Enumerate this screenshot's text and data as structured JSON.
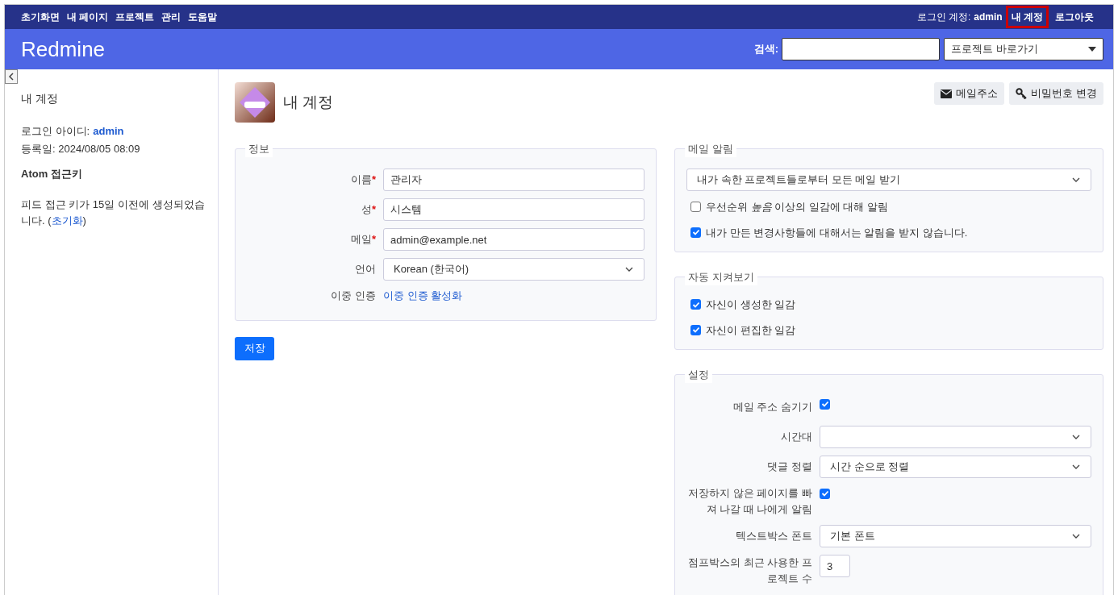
{
  "top_menu": {
    "items": [
      {
        "label": "초기화면"
      },
      {
        "label": "내 페이지"
      },
      {
        "label": "프로젝트"
      },
      {
        "label": "관리"
      },
      {
        "label": "도움말"
      }
    ],
    "logged_in_label": "로그인 계정:",
    "logged_in_user": "admin",
    "account_items": [
      {
        "label": "내 계정",
        "highlighted": true
      },
      {
        "label": "로그아웃",
        "highlighted": false
      }
    ]
  },
  "header": {
    "title": "Redmine",
    "search_label": "검색:",
    "jump_placeholder": "프로젝트 바로가기"
  },
  "sidebar": {
    "title": "내 계정",
    "login_label": "로그인 아이디:",
    "login_value": "admin",
    "registered": "등록일: 2024/08/05 08:09",
    "atom_title": "Atom 접근키",
    "feed_text": "피드 접근 키가 15일 이전에 생성되었습니다. (",
    "feed_link": "초기화",
    "feed_after": ")"
  },
  "page": {
    "title": "내 계정",
    "buttons": [
      {
        "label": "메일주소",
        "kind": "mail"
      },
      {
        "label": "비밀번호 변경",
        "kind": "key"
      }
    ]
  },
  "info": {
    "legend": "정보",
    "fields": [
      {
        "label": "이름",
        "required_mark": "*",
        "kind": "text",
        "value": "관리자"
      },
      {
        "label": "성",
        "required_mark": "*",
        "kind": "text",
        "value": "시스템"
      },
      {
        "label": "메일",
        "required_mark": "*",
        "kind": "text",
        "value": "admin@example.net"
      },
      {
        "label": "언어",
        "kind": "select",
        "value": "Korean (한국어)"
      },
      {
        "label": "이중 인증",
        "kind": "link",
        "value": "이중 인증 활성화"
      }
    ],
    "save": "저장"
  },
  "mail_notification": {
    "legend": "메일 알림",
    "select": "내가 속한 프로젝트들로부터 모든 메일 받기",
    "options": [
      {
        "label": "우선순위 *높음* 이상의 일감에 대해 알림",
        "checked": false
      },
      {
        "label": "내가 만든 변경사항들에 대해서는 알림을 받지 않습니다.",
        "checked": true
      }
    ]
  },
  "auto_watch": {
    "legend": "자동 지켜보기",
    "options": [
      {
        "label": "자신이 생성한 일감",
        "checked": true
      },
      {
        "label": "자신이 편집한 일감",
        "checked": true
      }
    ]
  },
  "preferences": {
    "legend": "설정",
    "rows": [
      {
        "label": "메일 주소 숨기기",
        "kind": "checkbox",
        "checked": true
      },
      {
        "label": "시간대",
        "kind": "select"
      },
      {
        "label": "댓글 정렬",
        "kind": "select",
        "value": "시간 순으로 정렬"
      },
      {
        "label": "저장하지 않은 페이지를 빠져 나갈 때 나에게 알림",
        "kind": "checkbox",
        "checked": true
      },
      {
        "label": "텍스트박스 폰트",
        "kind": "select",
        "value": "기본 폰트"
      },
      {
        "label": "점프박스의 최근 사용한 프로젝트 수",
        "kind": "number",
        "value": "3"
      }
    ]
  }
}
